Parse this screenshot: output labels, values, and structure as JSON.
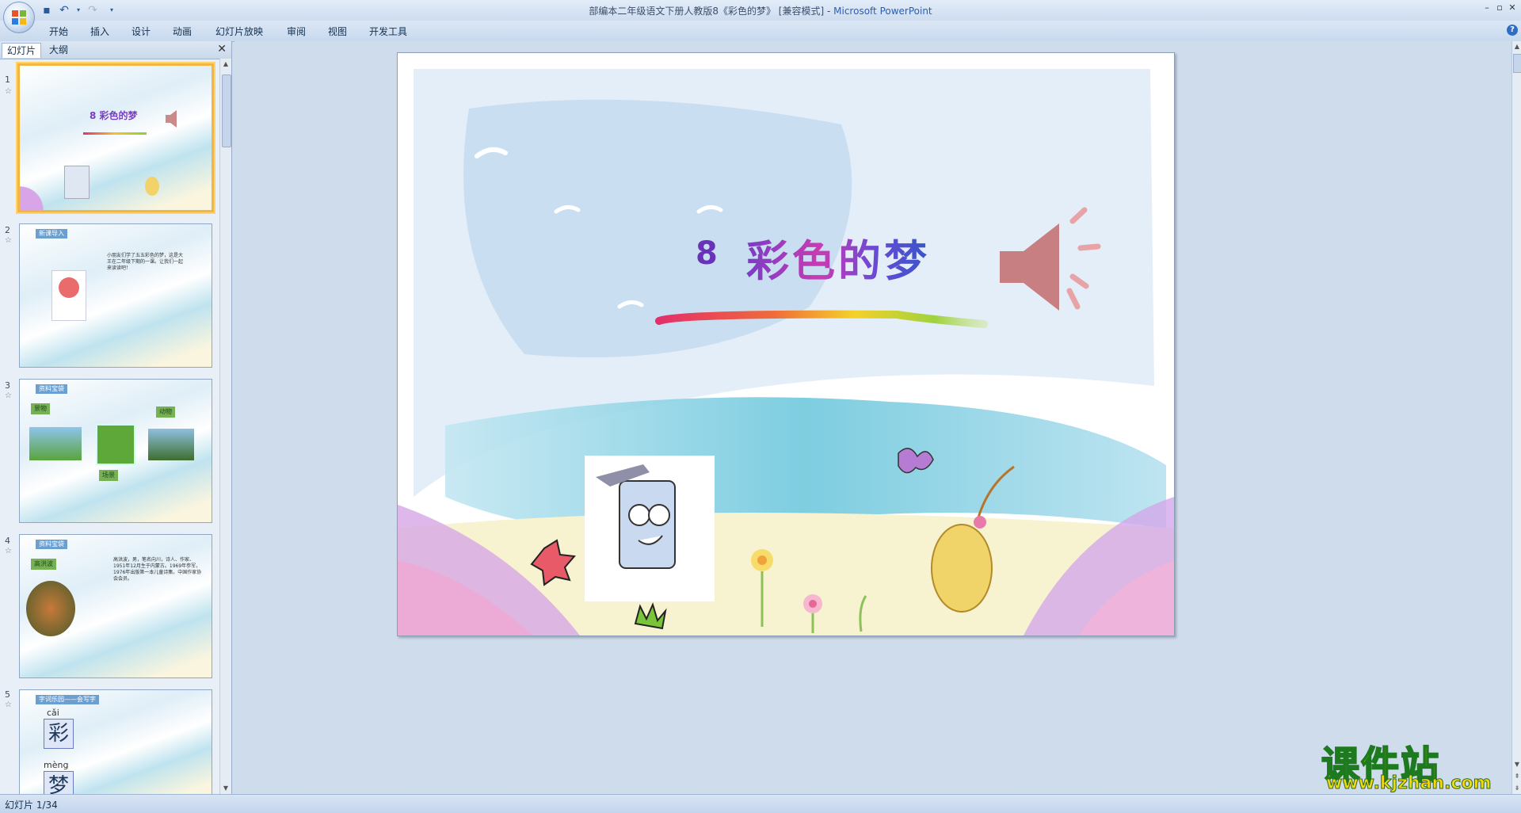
{
  "window": {
    "title": "部编本二年级语文下册人教版8《彩色的梦》 [兼容模式] - ",
    "app_name": "Microsoft PowerPoint",
    "controls": [
      "–",
      "▫",
      "✕"
    ]
  },
  "ribbon": {
    "tabs": [
      "开始",
      "插入",
      "设计",
      "动画",
      "幻灯片放映",
      "审阅",
      "视图",
      "开发工具"
    ]
  },
  "panel": {
    "tabs": [
      "幻灯片",
      "大纲"
    ],
    "close": "✕",
    "slides": [
      {
        "number": "1",
        "title": "8 彩色的梦"
      },
      {
        "number": "2",
        "tag": "新课导入",
        "text": "小朋友们学了五五彩色的梦，这是大王在二年级下期的一课。让我们一起来读读吧！"
      },
      {
        "number": "3",
        "tag": "资料宝袋",
        "labels": [
          "景物",
          "动物",
          "场景"
        ]
      },
      {
        "number": "4",
        "tag": "资料宝袋",
        "label": "高洪波",
        "text": "高洪波，男，笔名向川，诗人、作家、1951年12月生于内蒙古。1969年参军，1976年出版第一本儿童诗集。中国作家协会会员。"
      },
      {
        "number": "5",
        "tag": "字词乐园——会写字",
        "pinyin": [
          "cǎi",
          "mèng"
        ],
        "chars": [
          "彩",
          "梦"
        ]
      }
    ]
  },
  "slide": {
    "number": "8",
    "title": "彩色的梦"
  },
  "status": {
    "slide_info": "幻灯片 1/34"
  },
  "watermark": {
    "title": "课件站",
    "url": "www.kjzhan.com"
  }
}
